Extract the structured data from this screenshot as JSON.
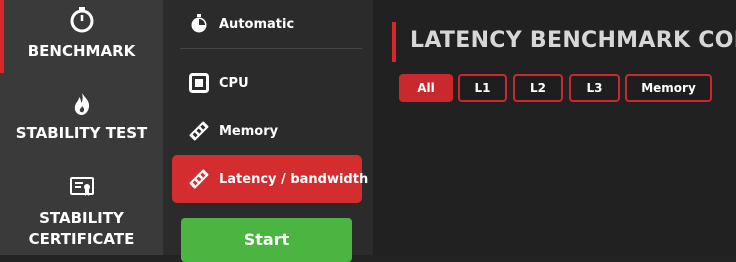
{
  "nav": {
    "items": [
      {
        "label": "BENCHMARK",
        "icon": "stopwatch-icon",
        "active": true
      },
      {
        "label": "STABILITY TEST",
        "icon": "flame-icon"
      },
      {
        "label": "STABILITY CERTIFICATE",
        "icon": "certificate-icon"
      }
    ]
  },
  "subnav": {
    "items": [
      {
        "label": "Automatic",
        "icon": "stopwatch-icon"
      },
      {
        "label": "CPU",
        "icon": "cpu-icon"
      },
      {
        "label": "Memory",
        "icon": "memory-icon"
      },
      {
        "label": "Latency / bandwidth",
        "icon": "memory-icon",
        "active": true
      }
    ],
    "start_label": "Start"
  },
  "main": {
    "title": "LATENCY BENCHMARK CONF",
    "filters": [
      "All",
      "L1",
      "L2",
      "L3",
      "Memory"
    ],
    "active_filter": "All"
  },
  "colors": {
    "accent": "#d32d30",
    "start": "#4cb541"
  }
}
